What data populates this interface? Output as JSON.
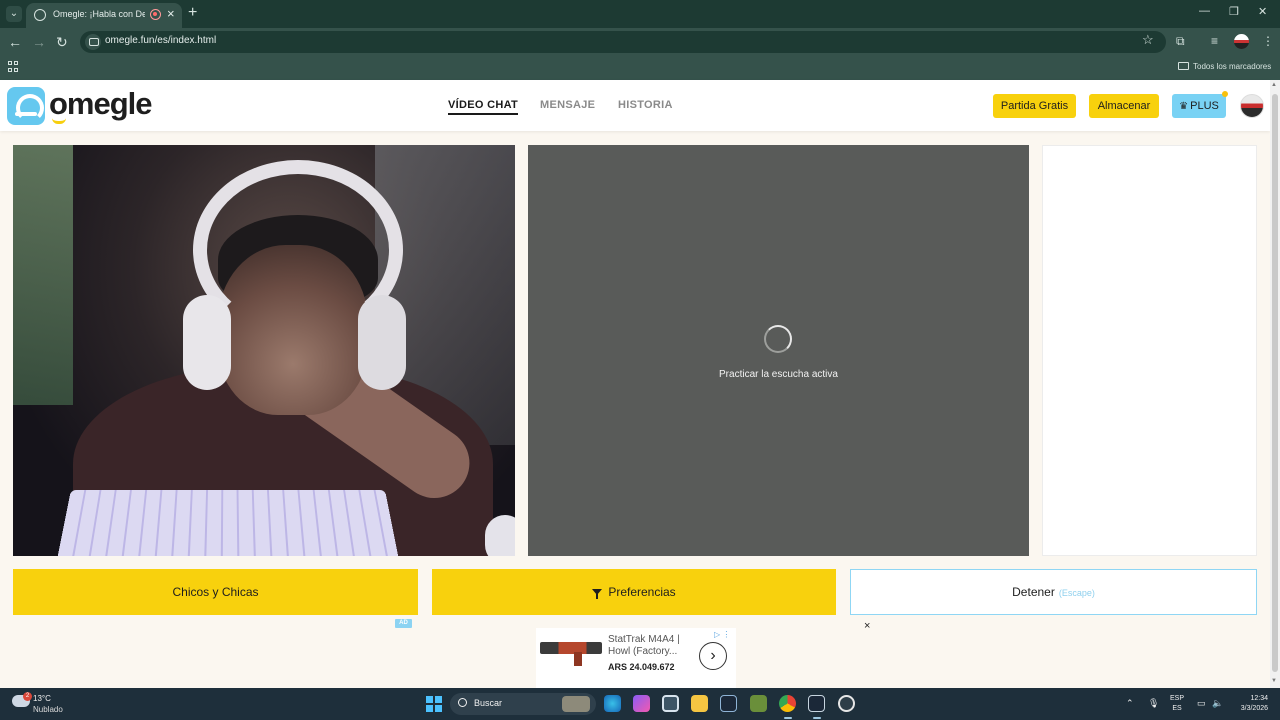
{
  "browser": {
    "tab_title": "Omegle: ¡Habla con Descon",
    "tab_close": "×",
    "new_tab": "+",
    "url": "omegle.fun/es/index.html",
    "bookmarks_label": "Todos los marcadores",
    "icons": [
      "tab-list-icon",
      "favicon-icon",
      "recording-icon",
      "back-icon",
      "forward-icon",
      "reload-icon",
      "site-info-icon",
      "bookmark-star-icon",
      "extensions-icon",
      "media-icon",
      "menu-icon",
      "apps-icon",
      "folder-icon",
      "minimize-icon",
      "restore-icon",
      "close-window-icon"
    ]
  },
  "header": {
    "logo_text": "omegle",
    "nav": [
      {
        "label": "VÍDEO CHAT",
        "active": true
      },
      {
        "label": "MENSAJE",
        "active": false
      },
      {
        "label": "HISTORIA",
        "active": false
      }
    ],
    "buttons": {
      "free_match": "Partida Gratis",
      "store": "Almacenar",
      "plus": "PLUS"
    }
  },
  "remote_video": {
    "status_text": "Practicar la escucha activa"
  },
  "actions": {
    "gender_filter": "Chicos y Chicas",
    "preferences": "Preferencias",
    "stop": "Detener",
    "stop_hint": "(Escape)"
  },
  "ad": {
    "badge": "AD",
    "close": "×",
    "title": "StatTrak M4A4 | Howl (Factory...",
    "price": "ARS 24.049.672",
    "arrow": "›"
  },
  "taskbar": {
    "weather_temp": "13°C",
    "weather_desc": "Nublado",
    "weather_badge": "2",
    "search_placeholder": "Buscar",
    "lang_top": "ESP",
    "lang_bottom": "ES",
    "time": "12:34",
    "date": "3/3/2026"
  },
  "colors": {
    "accent_yellow": "#f8d10d",
    "accent_blue": "#79d2f4",
    "remote_bg": "#595b59",
    "chrome_dark": "#1d3a33"
  }
}
